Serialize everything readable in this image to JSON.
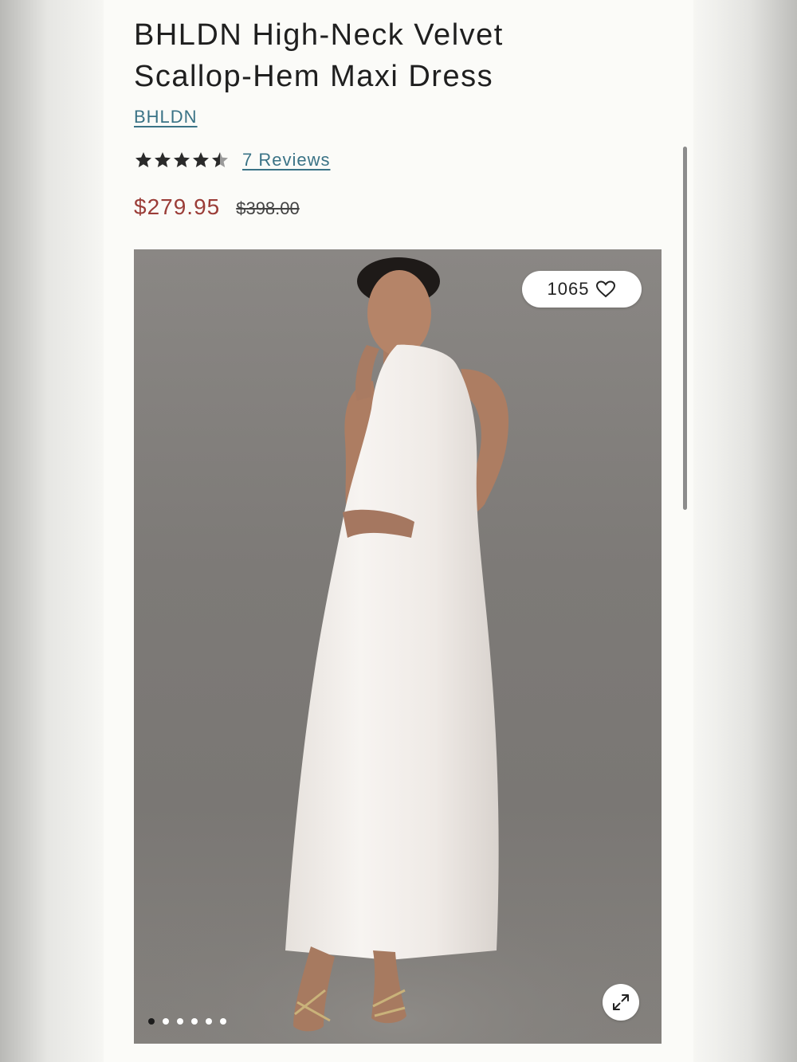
{
  "product": {
    "title": "BHLDN High-Neck Velvet Scallop-Hem Maxi Dress",
    "brand": "BHLDN",
    "rating": 4.5,
    "rating_max": 5,
    "reviews_label": "7 Reviews",
    "sale_price": "$279.95",
    "original_price": "$398.00"
  },
  "gallery": {
    "likes_count": "1065",
    "icons": {
      "likes": "heart-icon",
      "expand": "expand-icon"
    },
    "slide_count": 6,
    "active_slide": 1
  },
  "colors": {
    "link": "#3a7386",
    "sale": "#9b3d38",
    "photo_background": "#7f7c79"
  }
}
